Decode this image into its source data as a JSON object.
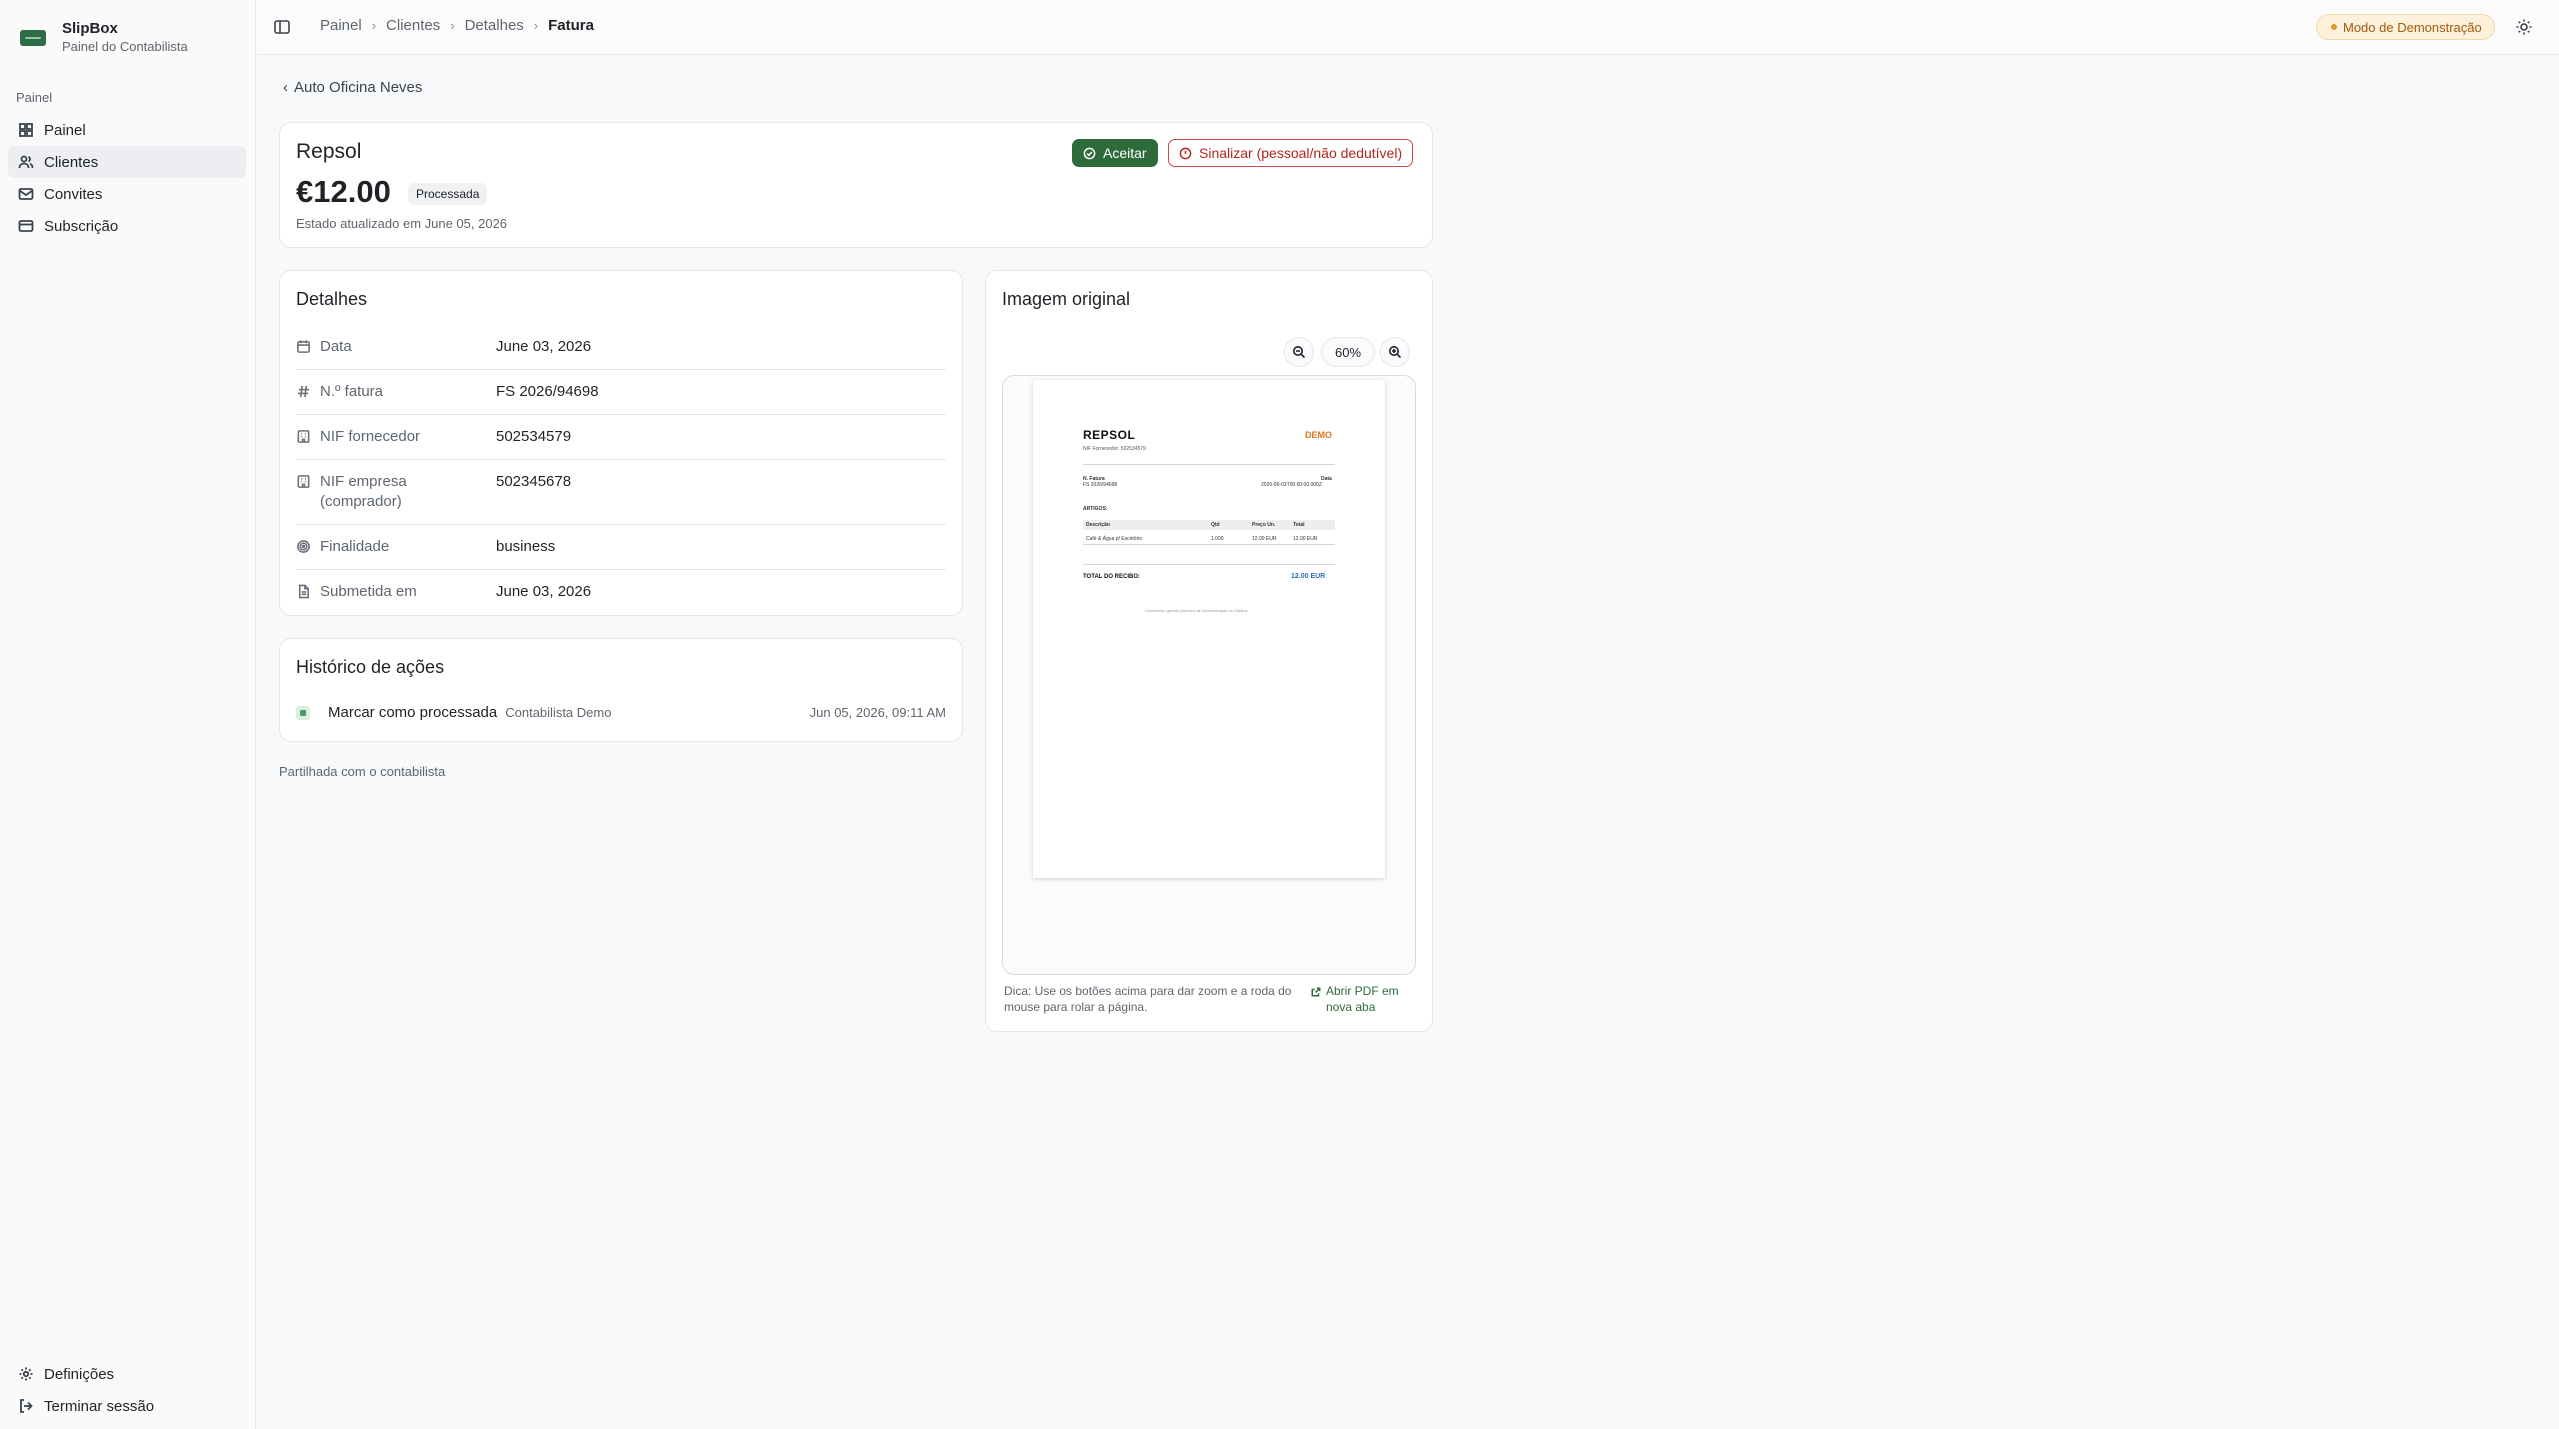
{
  "brand": {
    "name": "SlipBox",
    "subtitle": "Painel do Contabilista"
  },
  "sidebar": {
    "section_label": "Painel",
    "items": [
      {
        "label": "Painel",
        "icon": "grid-icon",
        "active": false
      },
      {
        "label": "Clientes",
        "icon": "users-icon",
        "active": true
      },
      {
        "label": "Convites",
        "icon": "mail-icon",
        "active": false
      },
      {
        "label": "Subscrição",
        "icon": "credit-card-icon",
        "active": false
      }
    ],
    "bottom_items": [
      {
        "label": "Definições",
        "icon": "gear-icon"
      },
      {
        "label": "Terminar sessão",
        "icon": "logout-icon"
      }
    ]
  },
  "topbar": {
    "breadcrumbs": [
      "Painel",
      "Clientes",
      "Detalhes",
      "Fatura"
    ],
    "demo_badge": "Modo de Demonstração"
  },
  "back_link": "Auto Oficina Neves",
  "invoice": {
    "vendor": "Repsol",
    "amount": "€12.00",
    "status": "Processada",
    "status_updated": "Estado atualizado em June 05, 2026",
    "accept_label": "Aceitar",
    "flag_label": "Sinalizar (pessoal/não dedutível)"
  },
  "details": {
    "title": "Detalhes",
    "rows": [
      {
        "label": "Data",
        "value": "June 03, 2026",
        "icon": "calendar-icon"
      },
      {
        "label": "N.º fatura",
        "value": "FS 2026/94698",
        "icon": "hash-icon"
      },
      {
        "label": "NIF fornecedor",
        "value": "502534579",
        "icon": "building-icon"
      },
      {
        "label": "NIF empresa (comprador)",
        "value": "502345678",
        "icon": "building-icon"
      },
      {
        "label": "Finalidade",
        "value": "business",
        "icon": "target-icon"
      },
      {
        "label": "Submetida em",
        "value": "June 03, 2026",
        "icon": "file-icon"
      }
    ]
  },
  "history": {
    "title": "Histórico de ações",
    "entries": [
      {
        "action": "Marcar como processada",
        "who": "Contabilista Demo",
        "time": "Jun 05, 2026, 09:11 AM"
      }
    ]
  },
  "shared_note": "Partilhada com o contabilista",
  "image_panel": {
    "title": "Imagem original",
    "zoom_level": "60%",
    "hint": "Dica: Use os botões acima para dar zoom e a roda do mouse para rolar a página.",
    "open_pdf": "Abrir PDF em nova aba"
  },
  "receipt": {
    "title": "REPSOL",
    "nif_line": "NIF Fornecedor: 502534579",
    "demo": "DEMO",
    "invoice_label": "N. Fatura",
    "invoice_value": "FS 2026/94698",
    "date_label": "Data",
    "date_value": "2026-06-03T00:00:00.000Z",
    "items_label": "ARTIGOS:",
    "col_desc": "Descrição",
    "col_qty": "Qtd",
    "col_unit": "Preço Un.",
    "col_total": "Total",
    "item_desc": "Café & Água p/ Escritório",
    "item_qty": "1.000",
    "item_unit": "12.00 EUR",
    "item_total": "12.00 EUR",
    "total_label": "TOTAL DO RECIBO:",
    "total_value": "12.00 EUR",
    "footer": "Documento gerado para fins de demonstração no SlipBox"
  },
  "colors": {
    "accent": "#2e6b3a",
    "danger": "#b3261e",
    "demo": "#a25b0b"
  }
}
